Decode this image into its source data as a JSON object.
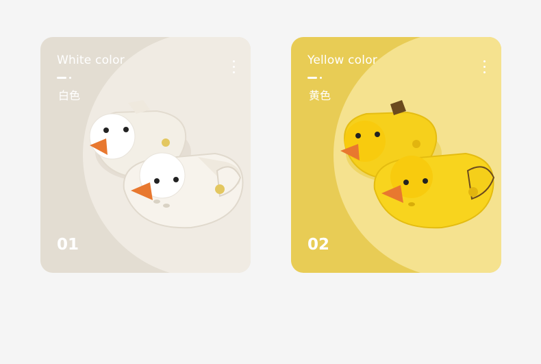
{
  "cards": [
    {
      "title": "White color",
      "subtitle": "白色",
      "number": "01",
      "variant": "white"
    },
    {
      "title": "Yellow color",
      "subtitle": "黄色",
      "number": "02",
      "variant": "yellow"
    }
  ],
  "colors": {
    "white_card_bg": "#e3ddd2",
    "white_circle": "#f0ebe3",
    "yellow_card_bg": "#e8cc55",
    "yellow_circle": "#f5e28f",
    "beak": "#e8782f",
    "white_shoe": "#f3efe6",
    "yellow_shoe": "#f5cf1a"
  },
  "icons": [
    "more-dots-icon",
    "duck-slipper-illustration"
  ]
}
